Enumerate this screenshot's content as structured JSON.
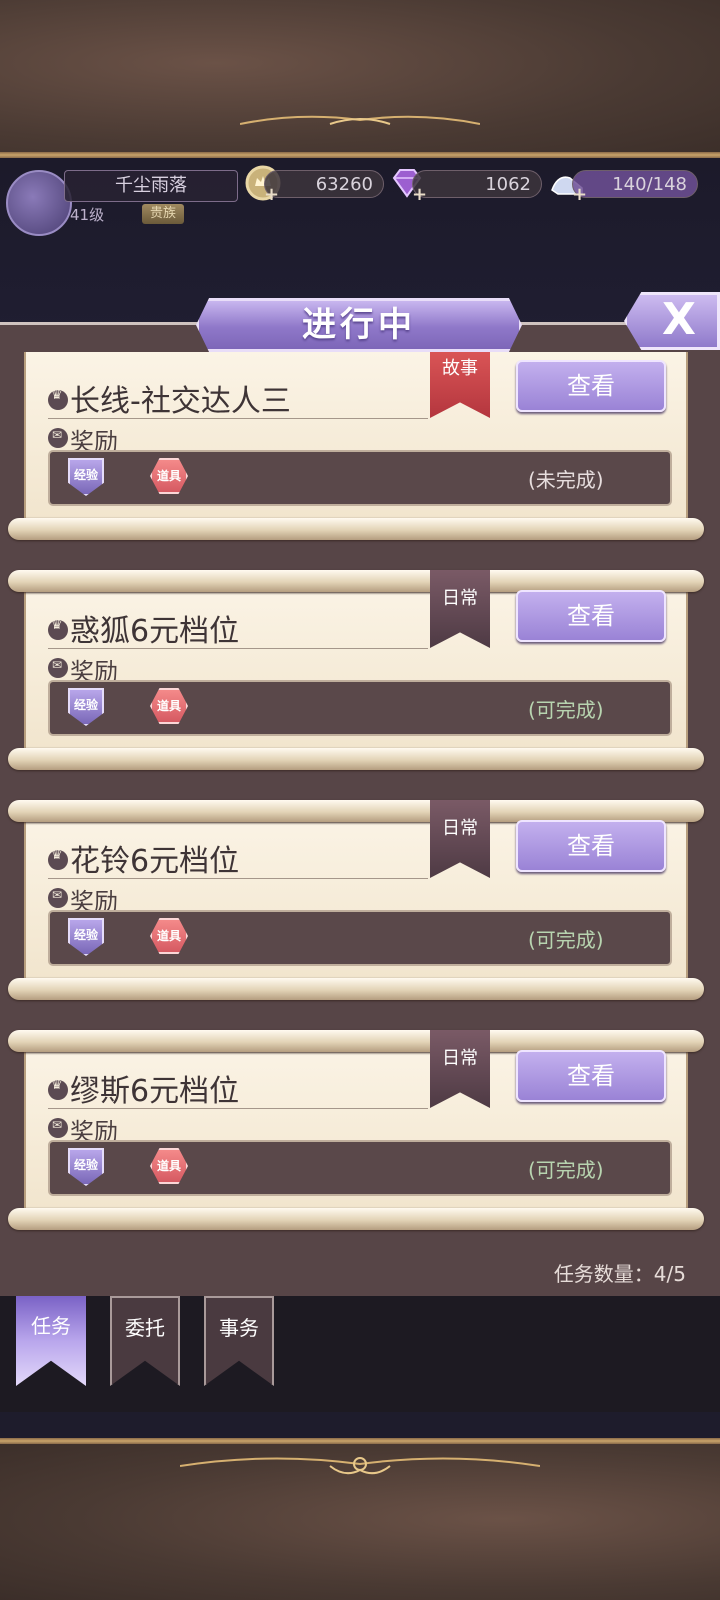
{
  "player": {
    "name": "千尘雨落",
    "level": "41级",
    "level_tag": "贵族"
  },
  "resources": {
    "gold": "63260",
    "gems": "1062",
    "stamina": "140/148"
  },
  "header": {
    "title": "进行中",
    "close_label": "X"
  },
  "tasks": [
    {
      "title": "长线-社交达人三",
      "ribbon": "故事",
      "reward_label": "奖励",
      "badge_exp": "经验",
      "badge_item": "道具",
      "state": "(未完成)",
      "button": "查看"
    },
    {
      "title": "惑狐6元档位",
      "ribbon": "日常",
      "reward_label": "奖励",
      "badge_exp": "经验",
      "badge_item": "道具",
      "state": "(可完成)",
      "button": "查看"
    },
    {
      "title": "花铃6元档位",
      "ribbon": "日常",
      "reward_label": "奖励",
      "badge_exp": "经验",
      "badge_item": "道具",
      "state": "(可完成)",
      "button": "查看"
    },
    {
      "title": "缪斯6元档位",
      "ribbon": "日常",
      "reward_label": "奖励",
      "badge_exp": "经验",
      "badge_item": "道具",
      "state": "(可完成)",
      "button": "查看"
    }
  ],
  "task_count": "任务数量：4/5",
  "tabs": [
    "任务",
    "委托",
    "事务"
  ]
}
